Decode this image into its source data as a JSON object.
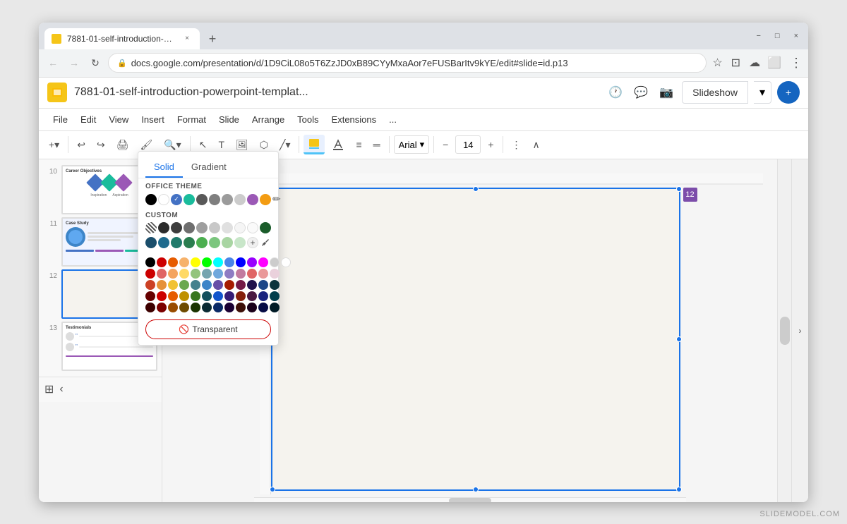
{
  "browser": {
    "tab_title": "7881-01-self-introduction-powe...",
    "url": "docs.google.com/presentation/d/1D9CiL08o5T6ZzJD0xB89CYyMxaAor7eFUSBarItv9kYE/edit#slide=id.p13",
    "new_tab_icon": "+",
    "nav": {
      "back": "←",
      "forward": "→",
      "reload": "↻"
    },
    "window_controls": {
      "minimize": "−",
      "maximize": "□",
      "close": "×"
    }
  },
  "app": {
    "title": "7881-01-self-introduction-powerpoint-templat...",
    "menu_items": [
      "File",
      "Edit",
      "View",
      "Insert",
      "Format",
      "Slide",
      "Arrange",
      "Tools",
      "Extensions",
      "..."
    ],
    "slideshow_btn": "Slideshow",
    "toolbar": {
      "font": "Arial",
      "font_size": "14",
      "zoom": "−",
      "plus": "+"
    }
  },
  "slides": [
    {
      "number": "10",
      "label": "Career Objectives"
    },
    {
      "number": "11",
      "label": "Case Study"
    },
    {
      "number": "12",
      "label": ""
    },
    {
      "number": "13",
      "label": "Testimonials"
    }
  ],
  "color_picker": {
    "tabs": [
      "Solid",
      "Gradient"
    ],
    "active_tab": "Solid",
    "sections": {
      "office_theme": {
        "label": "OFFICE THEME",
        "colors": [
          "#000000",
          "#ffffff",
          "#4472c4",
          "#244185",
          "#5e7fc3",
          "#7f7f7f",
          "#595959",
          "#262626",
          "#9b59b6",
          "#1abc9c",
          "#f39c12"
        ]
      },
      "custom": {
        "label": "CUSTOM"
      }
    },
    "transparent_btn": "Transparent"
  },
  "slide_number_badge": "12",
  "watermark": "SLIDEMODEL.COM"
}
